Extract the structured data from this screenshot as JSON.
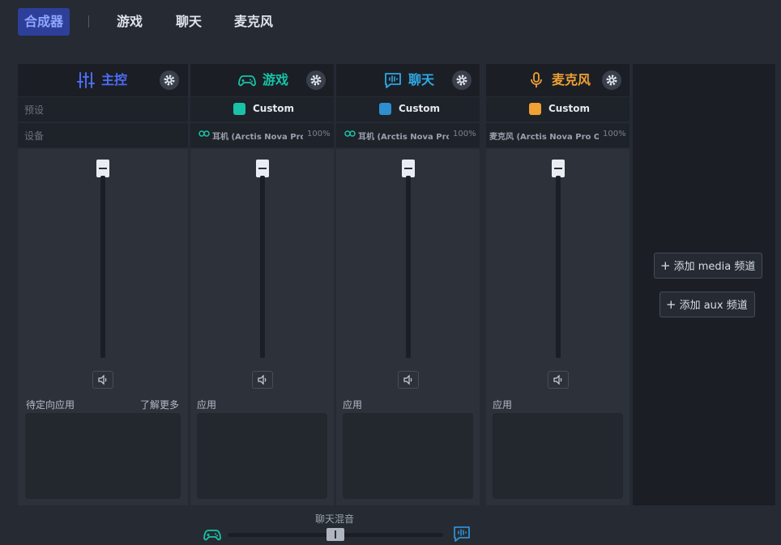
{
  "nav": {
    "tabs": [
      {
        "label": "合成器",
        "active": true
      },
      {
        "label": "游戏",
        "active": false
      },
      {
        "label": "聊天",
        "active": false
      },
      {
        "label": "麦克风",
        "active": false
      }
    ]
  },
  "columns": [
    {
      "key": "master",
      "title": "主控",
      "color": "#4d6cf5",
      "icon": "sliders-icon",
      "preset_label": "预设",
      "device_label": "设备",
      "apps_label": "待定向应用",
      "learn_more": "了解更多"
    },
    {
      "key": "game",
      "title": "游戏",
      "color": "#18c3a8",
      "icon": "gamepad-icon",
      "preset": "Custom",
      "device": "耳机 (Arctis Nova Pro...",
      "device_volume": "100%",
      "apps_label": "应用"
    },
    {
      "key": "chat",
      "title": "聊天",
      "color": "#2ea8e6",
      "icon": "chat-icon",
      "preset": "Custom",
      "device": "耳机 (Arctis Nova Pro...",
      "device_volume": "100%",
      "apps_label": "应用"
    },
    {
      "key": "mic",
      "title": "麦克风",
      "color": "#f0a034",
      "icon": "microphone-icon",
      "preset": "Custom",
      "device": "麦克风 (Arctis Nova Pro O...",
      "device_volume": "100%",
      "apps_label": "应用"
    }
  ],
  "add_buttons": {
    "media": "添加 media 频道",
    "aux": "添加 aux 频道"
  },
  "chatmix": {
    "label": "聊天混音",
    "balance": 0.5
  }
}
